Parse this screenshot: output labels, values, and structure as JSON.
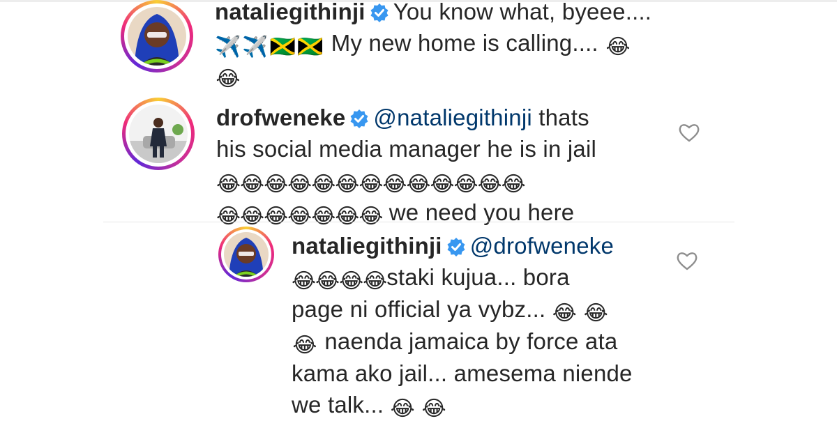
{
  "comments": [
    {
      "username": "nataliegithinji",
      "mention": "",
      "lines": [
        {
          "before": "",
          "text": "You know what, byeee....",
          "after": ""
        },
        {
          "before": "✈️✈️🇯🇲🇯🇲",
          "text": "My new home is calling....",
          "after": "😂"
        },
        {
          "before": "😂",
          "text": "",
          "after": ""
        }
      ]
    },
    {
      "username": "drofweneke",
      "mention": "@nataliegithinji",
      "lines": [
        {
          "before": "",
          "text": "thats",
          "after": ""
        },
        {
          "before": "",
          "text": "his social media manager he is in jail",
          "after": ""
        },
        {
          "before": "😂😂😂😂😂😂😂😂😂😂😂😂😂",
          "text": "",
          "after": ""
        },
        {
          "before": "😂😂😂😂😂😂😂",
          "text": "we need you here",
          "after": ""
        }
      ]
    },
    {
      "username": "nataliegithinji",
      "mention": "@drofweneke",
      "lines": [
        {
          "before": "😂😂😂😂",
          "text": "staki kujua... bora",
          "after": ""
        },
        {
          "before": "",
          "text": "page ni official ya vybz...",
          "after": "😂 😂"
        },
        {
          "before": "😂",
          "text": "naenda jamaica by force ata",
          "after": ""
        },
        {
          "before": "",
          "text": "kama ako jail... amesema niende",
          "after": ""
        },
        {
          "before": "",
          "text": "we talk...",
          "after": "😂 😂"
        }
      ]
    }
  ],
  "icons": {
    "verified": "verified-badge-icon",
    "like": "heart-icon"
  },
  "colors": {
    "verified": "#3897f0",
    "mention": "#00376b",
    "text": "#262626"
  }
}
